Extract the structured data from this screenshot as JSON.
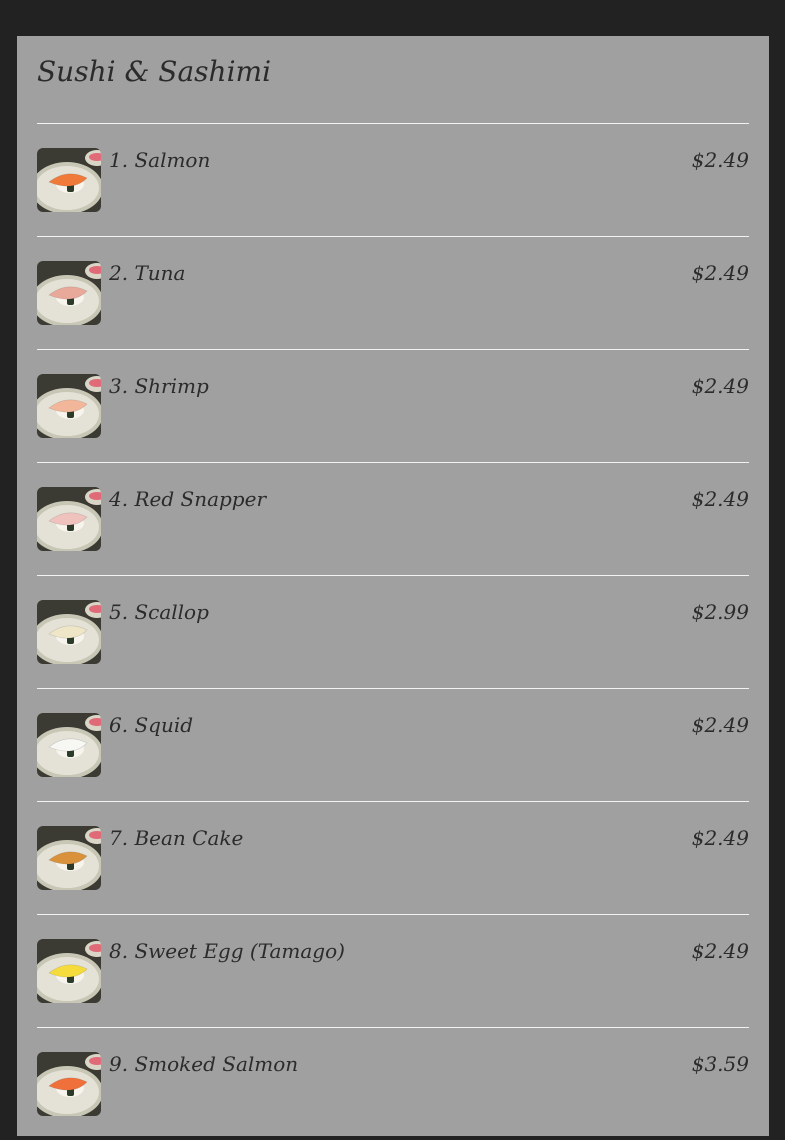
{
  "section": {
    "title": "Sushi & Sashimi"
  },
  "items": [
    {
      "name": "1. Salmon",
      "price": "$2.49",
      "image_icon": "salmon-nigiri-icon",
      "topping_color": "#f07a3a"
    },
    {
      "name": "2. Tuna",
      "price": "$2.49",
      "image_icon": "tuna-nigiri-icon",
      "topping_color": "#e8a89a"
    },
    {
      "name": "3. Shrimp",
      "price": "$2.49",
      "image_icon": "shrimp-nigiri-icon",
      "topping_color": "#f2b79a"
    },
    {
      "name": "4. Red Snapper",
      "price": "$2.49",
      "image_icon": "red-snapper-nigiri-icon",
      "topping_color": "#f0c2bd"
    },
    {
      "name": "5. Scallop",
      "price": "$2.99",
      "image_icon": "scallop-nigiri-icon",
      "topping_color": "#efe6c8"
    },
    {
      "name": "6. Squid",
      "price": "$2.49",
      "image_icon": "squid-nigiri-icon",
      "topping_color": "#f7f7f4"
    },
    {
      "name": "7. Bean Cake",
      "price": "$2.49",
      "image_icon": "bean-cake-nigiri-icon",
      "topping_color": "#d9913c"
    },
    {
      "name": "8. Sweet Egg (Tamago)",
      "price": "$2.49",
      "image_icon": "tamago-nigiri-icon",
      "topping_color": "#f5dc3c"
    },
    {
      "name": "9. Smoked Salmon",
      "price": "$3.59",
      "image_icon": "smoked-salmon-nigiri-icon",
      "topping_color": "#f0703c"
    }
  ],
  "colors": {
    "page_background": "#222222",
    "panel_background": "#a0a0a0",
    "text": "#2b2b2b",
    "divider": "#f2f2f2"
  }
}
